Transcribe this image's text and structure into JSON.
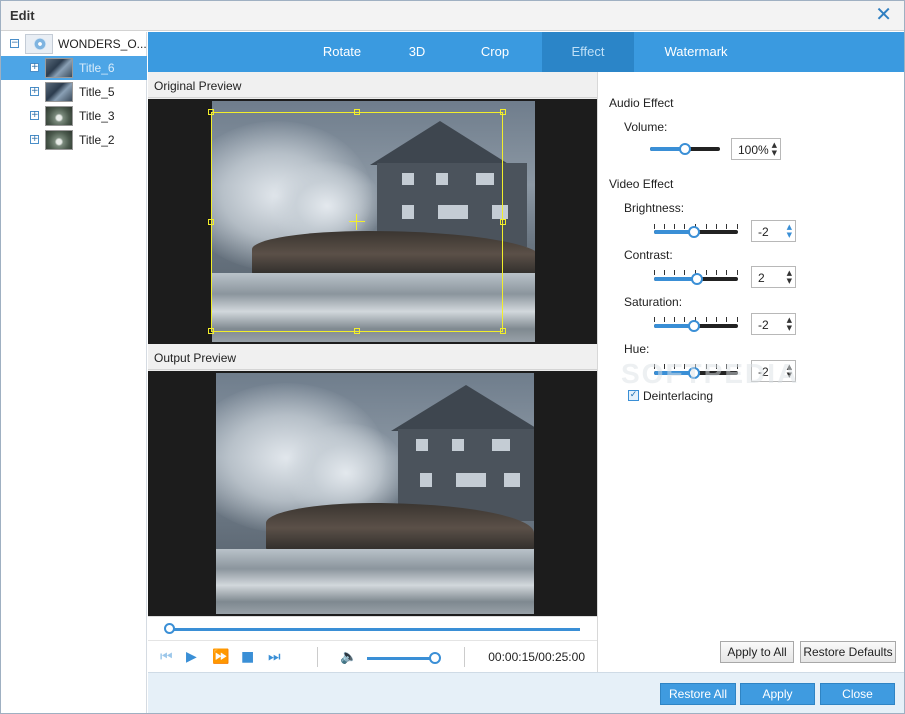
{
  "window": {
    "title": "Edit"
  },
  "tree": {
    "root": {
      "label": "WONDERS_O..."
    },
    "items": [
      {
        "label": "Title_6",
        "thumb": "storm",
        "selected": true
      },
      {
        "label": "Title_5",
        "thumb": "storm",
        "selected": false
      },
      {
        "label": "Title_3",
        "thumb": "drop",
        "selected": false
      },
      {
        "label": "Title_2",
        "thumb": "drop",
        "selected": false
      }
    ]
  },
  "tabs": [
    {
      "label": "Rotate",
      "active": false
    },
    {
      "label": "3D",
      "active": false
    },
    {
      "label": "Crop",
      "active": false
    },
    {
      "label": "Effect",
      "active": true
    },
    {
      "label": "Watermark",
      "active": false
    }
  ],
  "preview": {
    "original_label": "Original Preview",
    "output_label": "Output Preview",
    "timecode": "00:00:15/00:25:00",
    "playback_progress": 0.0,
    "volume_level": 0.95
  },
  "audio": {
    "title": "Audio Effect",
    "volume_label": "Volume:",
    "volume_value": "100%",
    "volume_slider": 0.5
  },
  "video": {
    "title": "Video Effect",
    "brightness_label": "Brightness:",
    "brightness_value": "-2",
    "contrast_label": "Contrast:",
    "contrast_value": "2",
    "saturation_label": "Saturation:",
    "saturation_value": "-2",
    "hue_label": "Hue:",
    "hue_value": "-2",
    "deinterlacing_label": "Deinterlacing",
    "deinterlacing_checked": true
  },
  "buttons": {
    "apply_to_all": "Apply to All",
    "restore_defaults": "Restore Defaults",
    "restore_all": "Restore All",
    "apply": "Apply",
    "close": "Close"
  },
  "watermark": "SOFTPEDIA",
  "colors": {
    "accent": "#3a9ae0",
    "active_tab": "#2b85c8",
    "crop": "#f2ee2a"
  }
}
